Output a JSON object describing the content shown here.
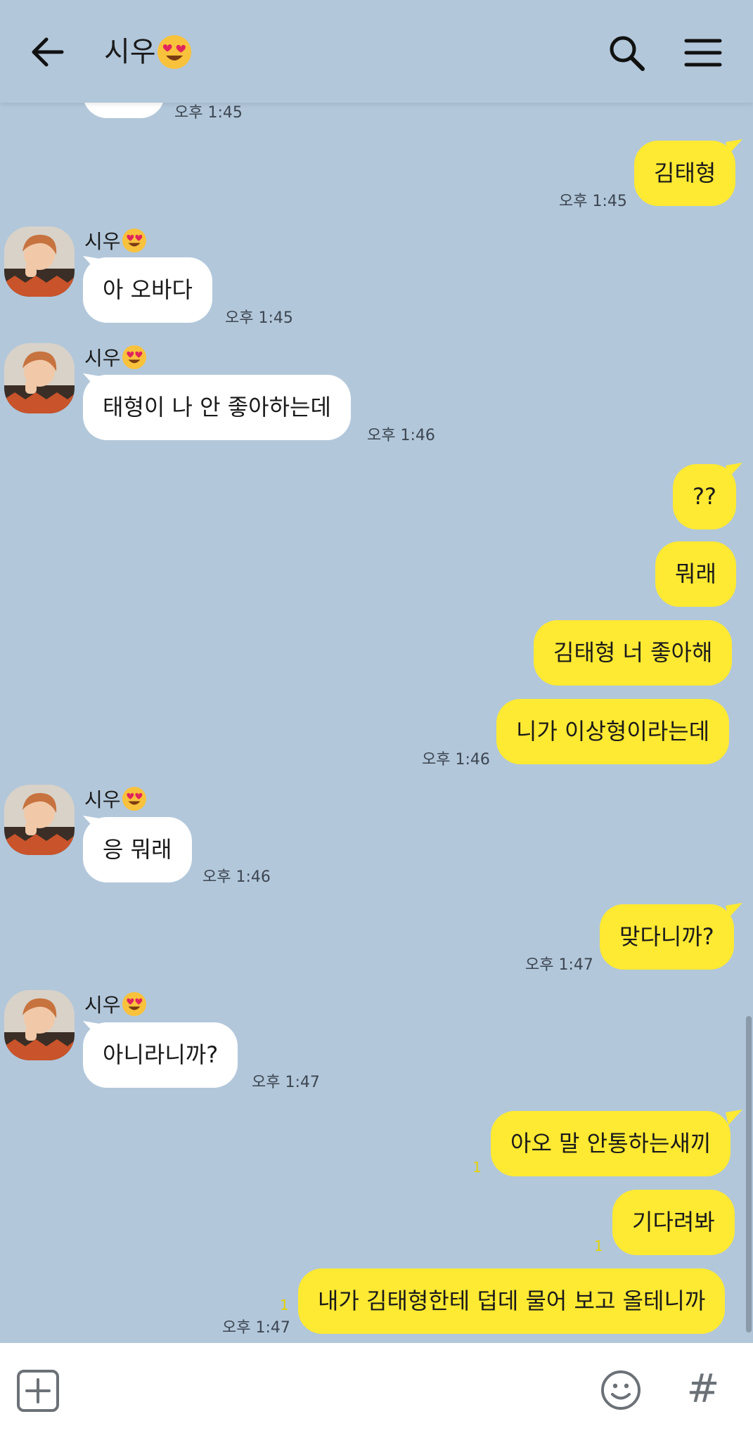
{
  "header": {
    "back_icon": "arrow-left-icon",
    "title": "시우",
    "title_emoji": "heart-eyes-emoji",
    "search_icon": "search-icon",
    "menu_icon": "hamburger-menu-icon"
  },
  "messages": [
    {
      "dir": "in",
      "text": "",
      "time": "오후 1:45"
    },
    {
      "dir": "out",
      "text": "김태형",
      "time": "오후 1:45"
    },
    {
      "dir": "in",
      "sender": "시우",
      "text": "아 오바다",
      "time": "오후 1:45"
    },
    {
      "dir": "in",
      "sender": "시우",
      "text": "태형이 나 안 좋아하는데",
      "time": "오후 1:46"
    },
    {
      "dir": "out",
      "text": "??"
    },
    {
      "dir": "out",
      "text": "뭐래"
    },
    {
      "dir": "out",
      "text": "김태형 너 좋아해"
    },
    {
      "dir": "out",
      "text": "니가 이상형이라는데",
      "time": "오후 1:46"
    },
    {
      "dir": "in",
      "sender": "시우",
      "text": "응 뭐래",
      "time": "오후 1:46"
    },
    {
      "dir": "out",
      "text": "맞다니까?",
      "time": "오후 1:47"
    },
    {
      "dir": "in",
      "sender": "시우",
      "text": "아니라니까?",
      "time": "오후 1:47"
    },
    {
      "dir": "out",
      "text": "아오 말 안통하는새끼",
      "unread": "1"
    },
    {
      "dir": "out",
      "text": "기다려봐",
      "unread": "1"
    },
    {
      "dir": "out",
      "text": "내가 김태형한테 덥데 물어 보고 올테니까",
      "unread": "1",
      "time": "오후 1:47"
    }
  ],
  "footer": {
    "add_icon": "plus-square-icon",
    "emoji_icon": "smiley-icon",
    "hash_label": "#"
  },
  "colors": {
    "background": "#b2c7da",
    "outgoing_bubble": "#fee933",
    "incoming_bubble": "#ffffff",
    "unread": "#e3d200"
  }
}
